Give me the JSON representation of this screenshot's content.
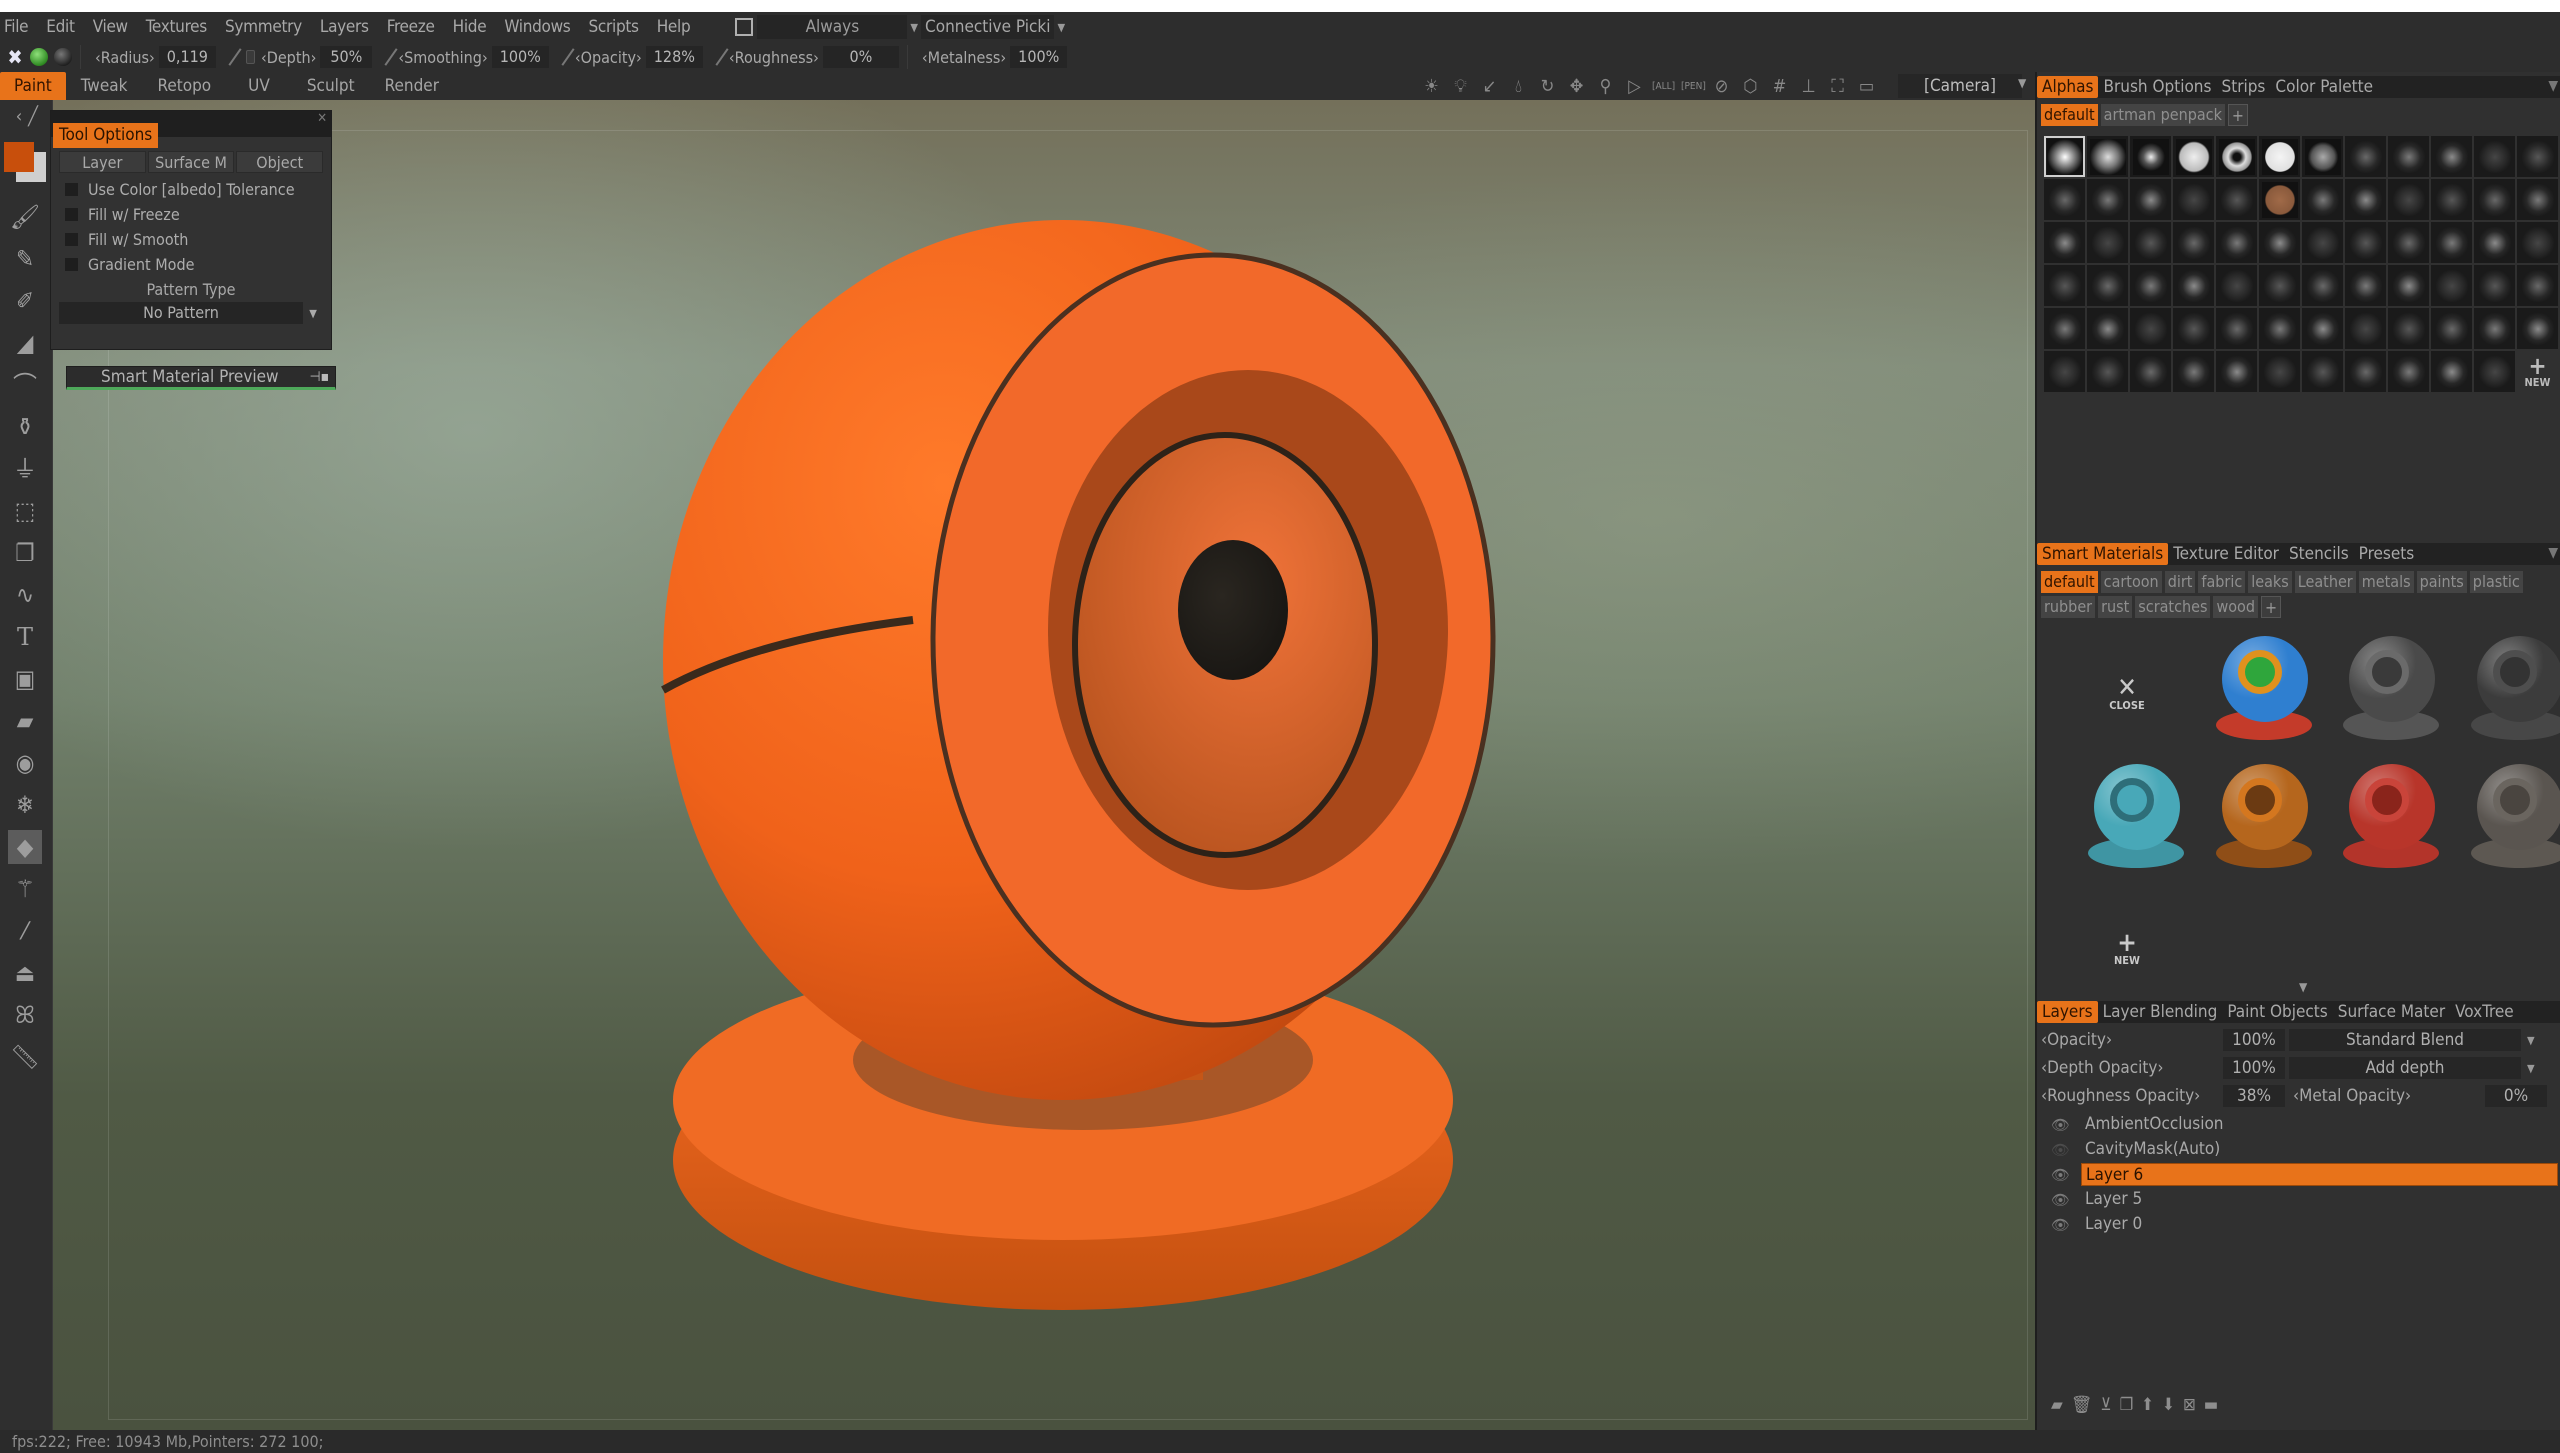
{
  "menu": {
    "items": [
      "File",
      "Edit",
      "View",
      "Textures",
      "Symmetry",
      "Layers",
      "Freeze",
      "Hide",
      "Windows",
      "Scripts",
      "Help"
    ],
    "always_value": "Always",
    "picking_value": "Connective Picki"
  },
  "toolbar": {
    "radius_label": "Radius",
    "radius_value": "0,119",
    "depth_label": "Depth",
    "depth_value": "50%",
    "smoothing_label": "Smoothing",
    "smoothing_value": "100%",
    "opacity_label": "Opacity",
    "opacity_value": "128%",
    "roughness_label": "Roughness",
    "roughness_value": "0%",
    "metalness_label": "Metalness",
    "metalness_value": "100%"
  },
  "mode_tabs": [
    {
      "label": "Paint",
      "active": true
    },
    {
      "label": "Tweak",
      "active": false
    },
    {
      "label": "Retopo",
      "active": false
    },
    {
      "label": "UV",
      "active": false
    },
    {
      "label": "Sculpt",
      "active": false
    },
    {
      "label": "Render",
      "active": false
    }
  ],
  "view_icons": [
    "light-icon",
    "bulb-icon",
    "light-direction-icon",
    "drop-icon",
    "rotate-icon",
    "move-icon",
    "zoom-icon",
    "perspective-icon",
    "frame-all-icon",
    "frame-pen-icon",
    "no-icon",
    "cube-icon",
    "grid-icon",
    "axis-icon",
    "fullscreen-icon",
    "image-icon"
  ],
  "camera": "[Camera]",
  "colors": {
    "accent": "#e8731a",
    "primary_color": "#c84f0c",
    "secondary_color": "#cfcfcf",
    "panel_bg": "#303030",
    "object_color": "#f0651c"
  },
  "tool_options": {
    "title": "Tool Options",
    "segments": [
      "Layer",
      "Surface M",
      "Object"
    ],
    "checkboxes": [
      {
        "label": "Use Color [albedo] Tolerance",
        "checked": false
      },
      {
        "label": "Fill w/ Freeze",
        "checked": false
      },
      {
        "label": "Fill w/ Smooth",
        "checked": false
      },
      {
        "label": "Gradient Mode",
        "checked": false
      }
    ],
    "pattern_type_label": "Pattern Type",
    "pattern_value": "No Pattern"
  },
  "smart_material_preview": "Smart Material Preview",
  "left_tools": [
    "airbrush-icon",
    "pencil-icon",
    "spray-icon",
    "brush-icon",
    "smudge-icon",
    "vase-icon",
    "stamp-icon",
    "transform-icon",
    "copy-icon",
    "curve-icon",
    "text-icon",
    "frame-icon",
    "eraser-icon",
    "eye-icon",
    "freeze-icon",
    "fill-icon",
    "magic-wand-icon",
    "pipette-icon",
    "iron-icon",
    "butterfly-icon",
    "ruler-icon"
  ],
  "alphas_panel": {
    "tabs": [
      {
        "label": "Alphas",
        "active": true
      },
      {
        "label": "Brush Options",
        "active": false
      },
      {
        "label": "Strips",
        "active": false
      },
      {
        "label": "Color Palette",
        "active": false
      }
    ],
    "sets": [
      {
        "label": "default",
        "active": true
      },
      {
        "label": "artman penpack",
        "active": false
      }
    ],
    "alpha_count": 71,
    "new_label": "NEW"
  },
  "smart_materials_panel": {
    "tabs": [
      {
        "label": "Smart Materials",
        "active": true
      },
      {
        "label": "Texture Editor",
        "active": false
      },
      {
        "label": "Stencils",
        "active": false
      },
      {
        "label": "Presets",
        "active": false
      }
    ],
    "folders": [
      {
        "label": "default",
        "active": true
      },
      {
        "label": "cartoon",
        "active": false
      },
      {
        "label": "dirt",
        "active": false
      },
      {
        "label": "fabric",
        "active": false
      },
      {
        "label": "leaks",
        "active": false
      },
      {
        "label": "Leather",
        "active": false
      },
      {
        "label": "metals",
        "active": false
      },
      {
        "label": "paints",
        "active": false
      },
      {
        "label": "plastic",
        "active": false
      },
      {
        "label": "rubber",
        "active": false
      },
      {
        "label": "rust",
        "active": false
      },
      {
        "label": "scratches",
        "active": false
      },
      {
        "label": "wood",
        "active": false
      }
    ],
    "close_label": "CLOSE",
    "new_label": "NEW",
    "materials": [
      {
        "name": "multicolor",
        "ball": "#2f7fd0",
        "eye": "#e0911e",
        "center": "#2fa63c",
        "base": "#c43b2a"
      },
      {
        "name": "dark-metal",
        "ball": "#4a4a4a",
        "eye": "#6a6a6a",
        "center": "#3a3a3a",
        "base": "#555"
      },
      {
        "name": "dark-gray",
        "ball": "#3c3c3c",
        "eye": "#4e4e4e",
        "center": "#333",
        "base": "#474747"
      },
      {
        "name": "cyan-carbon",
        "ball": "#48a8b8",
        "eye": "#2e6e79",
        "center": "#48a8b8",
        "base": "#3f95a3"
      },
      {
        "name": "orange-carbon",
        "ball": "#b5661d",
        "eye": "#d4771f",
        "center": "#6b3a12",
        "base": "#8f4e17"
      },
      {
        "name": "red-paint",
        "ball": "#b8352a",
        "eye": "#c9443a",
        "center": "#8a241b",
        "base": "#b3342a"
      },
      {
        "name": "stone",
        "ball": "#5a5550",
        "eye": "#6a655f",
        "center": "#4a4540",
        "base": "#5d5852"
      }
    ]
  },
  "layers_panel": {
    "tabs": [
      {
        "label": "Layers",
        "active": true
      },
      {
        "label": "Layer Blending",
        "active": false
      },
      {
        "label": "Paint Objects",
        "active": false
      },
      {
        "label": "Surface Mater",
        "active": false
      },
      {
        "label": "VoxTree",
        "active": false
      }
    ],
    "opacity_label": "Opacity",
    "opacity_value": "100%",
    "blend_mode": "Standard Blend",
    "depth_opacity_label": "Depth Opacity",
    "depth_opacity_value": "100%",
    "depth_mode": "Add depth",
    "roughness_opacity_label": "Roughness Opacity",
    "roughness_opacity_value": "38%",
    "metal_opacity_label": "Metal Opacity",
    "metal_opacity_value": "0%",
    "layers": [
      {
        "name": "AmbientOcclusion",
        "visible": true,
        "selected": false
      },
      {
        "name": "CavityMask(Auto)",
        "visible": false,
        "selected": false
      },
      {
        "name": "Layer 6",
        "visible": true,
        "selected": true
      },
      {
        "name": "Layer 5",
        "visible": true,
        "selected": false
      },
      {
        "name": "Layer 0",
        "visible": true,
        "selected": false
      }
    ],
    "actions": [
      "new-layer-icon",
      "delete-icon",
      "merge-down-icon",
      "duplicate-icon",
      "move-up-icon",
      "move-down-icon",
      "clear-icon",
      "folder-icon"
    ]
  },
  "status": "fps:222;   Free: 10943 Mb,Pointers: 272 100;"
}
